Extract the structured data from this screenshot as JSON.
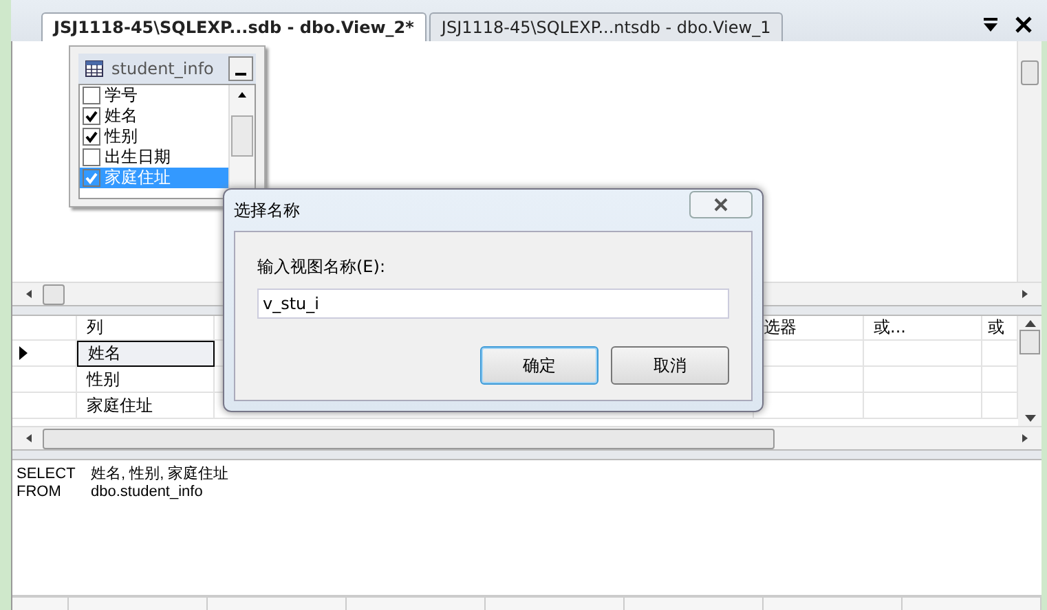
{
  "tabs": [
    {
      "label": "JSJ1118-45\\SQLEXP...sdb - dbo.View_2*",
      "selected": true
    },
    {
      "label": "JSJ1118-45\\SQLEXP...ntsdb - dbo.View_1",
      "selected": false
    }
  ],
  "diagram": {
    "table": {
      "title": "student_info",
      "columns": [
        {
          "name": "学号",
          "checked": false,
          "selected": false
        },
        {
          "name": "姓名",
          "checked": true,
          "selected": false
        },
        {
          "name": "性别",
          "checked": true,
          "selected": false
        },
        {
          "name": "出生日期",
          "checked": false,
          "selected": false
        },
        {
          "name": "家庭住址",
          "checked": true,
          "selected": true
        }
      ]
    }
  },
  "grid": {
    "columns": [
      "列",
      "选器",
      "或...",
      "或"
    ],
    "rows": [
      {
        "column": "姓名",
        "current": true
      },
      {
        "column": "性别",
        "current": false
      },
      {
        "column": "家庭住址",
        "current": false
      }
    ]
  },
  "sql": [
    {
      "keyword": "SELECT",
      "text": "姓名, 性别, 家庭住址"
    },
    {
      "keyword": "FROM",
      "text": "dbo.student_info"
    }
  ],
  "dialog": {
    "title": "选择名称",
    "label": "输入视图名称(E):",
    "value": "v_stu_i",
    "buttons": [
      {
        "label": "确定",
        "default": true
      },
      {
        "label": "取消",
        "default": false
      }
    ]
  }
}
